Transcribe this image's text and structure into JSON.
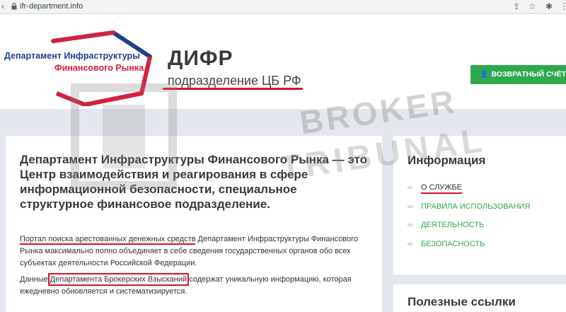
{
  "browser": {
    "url": "ifr-department.info"
  },
  "header": {
    "logo_line1": "Департамент Инфраструктуры",
    "logo_line2": "Финансового Рынка",
    "site_name": "ДИФР",
    "site_subtitle": "подразделение ЦБ РФ",
    "refund_button": "ВОЗВРАТНЫЙ СЧЁТ"
  },
  "watermark": {
    "line1": "BROKER",
    "line2": "TRIBUNAL"
  },
  "main": {
    "heading": "Департамент Инфраструктуры Финансового Рынка — это Центр взаимодействия и реагирования в сфере информационной безопасности, специальное структурное финансовое подразделение.",
    "para1_highlight": "Портал поиска арестованных денежных средств",
    "para1_rest": " Департамент Инфраструктуры Финансового Рынка максимально полно объединяет в себе сведения государственных органов обо всех субъектах деятельности Российской Федерации.",
    "para2_start": "Данные ",
    "para2_highlight": "Департамента Брокерских Взысканий",
    "para2_rest": " содержат уникальную информацию, которая ежедневно обновляется и систематизируется."
  },
  "sidebar": {
    "title": "Информация",
    "items": [
      {
        "label": "О СЛУЖБЕ"
      },
      {
        "label": "ПРАВИЛА ИСПОЛЬЗОВАНИЯ"
      },
      {
        "label": "ДЕЯТЕЛЬНОСТЬ"
      },
      {
        "label": "БЕЗОПАСНОСТЬ"
      }
    ],
    "title2": "Полезные ссылки"
  },
  "colors": {
    "accent_green": "#2fa84f",
    "highlight_red": "#e0102a",
    "logo_blue": "#1f3f8f",
    "logo_red": "#d4213d"
  }
}
